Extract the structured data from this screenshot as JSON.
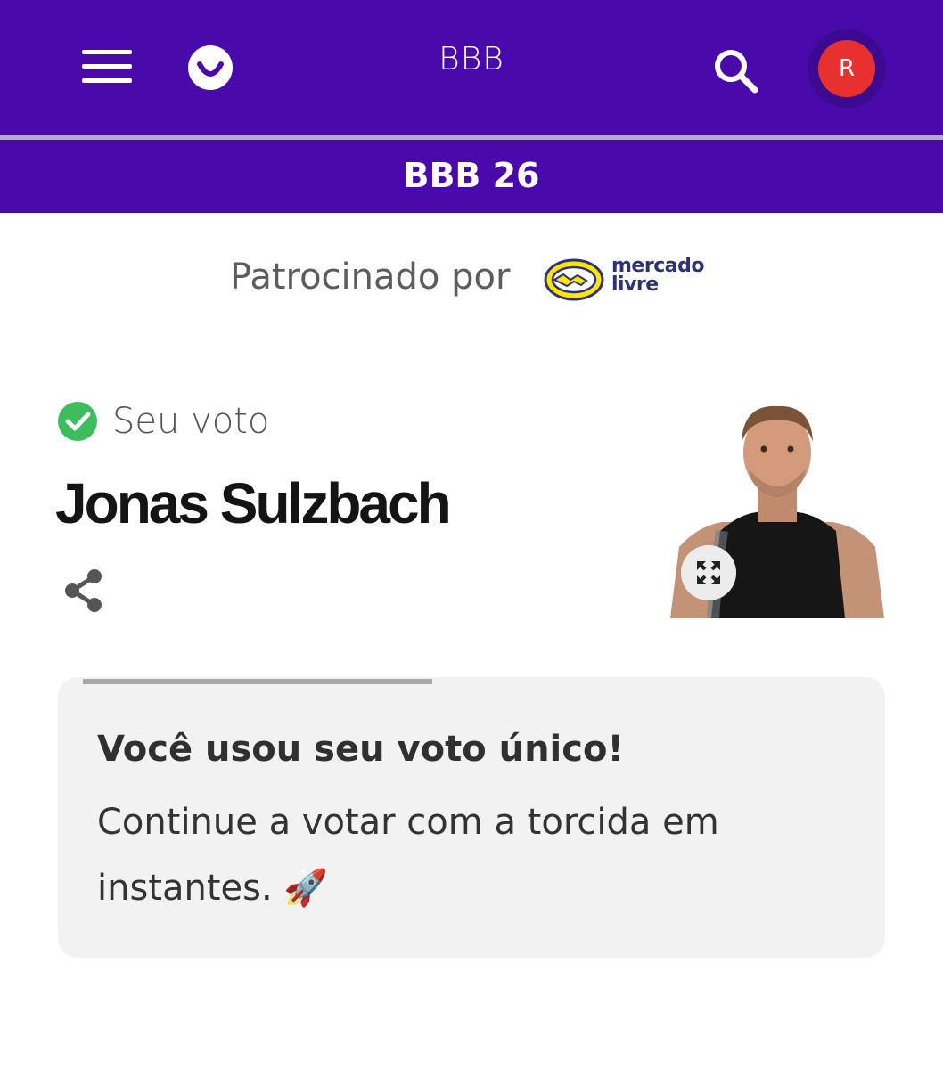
{
  "header": {
    "title": "BBB",
    "avatar_initial": "R",
    "menu_icon": "hamburger-menu-icon",
    "logo_icon": "smile-logo-icon",
    "search_icon": "search-icon",
    "background_color": "#4a0aab",
    "avatar_color": "#e8302f"
  },
  "subheader": {
    "title": "BBB 26"
  },
  "sponsor": {
    "label": "Patrocinado por",
    "brand_line1": "mercado",
    "brand_line2": "livre"
  },
  "vote": {
    "status_label": "Seu voto",
    "candidate_name": "Jonas Sulzbach",
    "check_color": "#3ebd5d",
    "share_icon": "share-icon",
    "expand_icon": "expand-icon"
  },
  "notice": {
    "title": "Você usou seu voto único!",
    "message": "Continue a votar com a torcida em instantes. 🚀",
    "progress": 0.45
  }
}
